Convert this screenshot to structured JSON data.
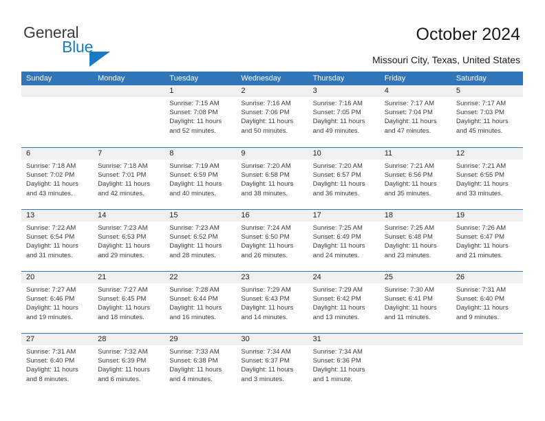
{
  "logo": {
    "word_one": "General",
    "word_two": "Blue",
    "triangle_icon": "triangle-icon",
    "accent_color": "#1a7bc4"
  },
  "header": {
    "title": "October 2024",
    "subtitle": "Missouri City, Texas, United States"
  },
  "theme": {
    "header_blue": "#3075b8",
    "date_band_gray": "#f0f0f0",
    "text_color": "#3a3a3a"
  },
  "calendar": {
    "day_headers": [
      "Sunday",
      "Monday",
      "Tuesday",
      "Wednesday",
      "Thursday",
      "Friday",
      "Saturday"
    ],
    "weeks": [
      [
        {
          "day": "",
          "empty": true
        },
        {
          "day": "",
          "empty": true
        },
        {
          "day": "1",
          "sunrise": "Sunrise: 7:15 AM",
          "sunset": "Sunset: 7:08 PM",
          "daylight": "Daylight: 11 hours and 52 minutes."
        },
        {
          "day": "2",
          "sunrise": "Sunrise: 7:16 AM",
          "sunset": "Sunset: 7:06 PM",
          "daylight": "Daylight: 11 hours and 50 minutes."
        },
        {
          "day": "3",
          "sunrise": "Sunrise: 7:16 AM",
          "sunset": "Sunset: 7:05 PM",
          "daylight": "Daylight: 11 hours and 49 minutes."
        },
        {
          "day": "4",
          "sunrise": "Sunrise: 7:17 AM",
          "sunset": "Sunset: 7:04 PM",
          "daylight": "Daylight: 11 hours and 47 minutes."
        },
        {
          "day": "5",
          "sunrise": "Sunrise: 7:17 AM",
          "sunset": "Sunset: 7:03 PM",
          "daylight": "Daylight: 11 hours and 45 minutes."
        }
      ],
      [
        {
          "day": "6",
          "sunrise": "Sunrise: 7:18 AM",
          "sunset": "Sunset: 7:02 PM",
          "daylight": "Daylight: 11 hours and 43 minutes."
        },
        {
          "day": "7",
          "sunrise": "Sunrise: 7:18 AM",
          "sunset": "Sunset: 7:01 PM",
          "daylight": "Daylight: 11 hours and 42 minutes."
        },
        {
          "day": "8",
          "sunrise": "Sunrise: 7:19 AM",
          "sunset": "Sunset: 6:59 PM",
          "daylight": "Daylight: 11 hours and 40 minutes."
        },
        {
          "day": "9",
          "sunrise": "Sunrise: 7:20 AM",
          "sunset": "Sunset: 6:58 PM",
          "daylight": "Daylight: 11 hours and 38 minutes."
        },
        {
          "day": "10",
          "sunrise": "Sunrise: 7:20 AM",
          "sunset": "Sunset: 6:57 PM",
          "daylight": "Daylight: 11 hours and 36 minutes."
        },
        {
          "day": "11",
          "sunrise": "Sunrise: 7:21 AM",
          "sunset": "Sunset: 6:56 PM",
          "daylight": "Daylight: 11 hours and 35 minutes."
        },
        {
          "day": "12",
          "sunrise": "Sunrise: 7:21 AM",
          "sunset": "Sunset: 6:55 PM",
          "daylight": "Daylight: 11 hours and 33 minutes."
        }
      ],
      [
        {
          "day": "13",
          "sunrise": "Sunrise: 7:22 AM",
          "sunset": "Sunset: 6:54 PM",
          "daylight": "Daylight: 11 hours and 31 minutes."
        },
        {
          "day": "14",
          "sunrise": "Sunrise: 7:23 AM",
          "sunset": "Sunset: 6:53 PM",
          "daylight": "Daylight: 11 hours and 29 minutes."
        },
        {
          "day": "15",
          "sunrise": "Sunrise: 7:23 AM",
          "sunset": "Sunset: 6:52 PM",
          "daylight": "Daylight: 11 hours and 28 minutes."
        },
        {
          "day": "16",
          "sunrise": "Sunrise: 7:24 AM",
          "sunset": "Sunset: 6:50 PM",
          "daylight": "Daylight: 11 hours and 26 minutes."
        },
        {
          "day": "17",
          "sunrise": "Sunrise: 7:25 AM",
          "sunset": "Sunset: 6:49 PM",
          "daylight": "Daylight: 11 hours and 24 minutes."
        },
        {
          "day": "18",
          "sunrise": "Sunrise: 7:25 AM",
          "sunset": "Sunset: 6:48 PM",
          "daylight": "Daylight: 11 hours and 23 minutes."
        },
        {
          "day": "19",
          "sunrise": "Sunrise: 7:26 AM",
          "sunset": "Sunset: 6:47 PM",
          "daylight": "Daylight: 11 hours and 21 minutes."
        }
      ],
      [
        {
          "day": "20",
          "sunrise": "Sunrise: 7:27 AM",
          "sunset": "Sunset: 6:46 PM",
          "daylight": "Daylight: 11 hours and 19 minutes."
        },
        {
          "day": "21",
          "sunrise": "Sunrise: 7:27 AM",
          "sunset": "Sunset: 6:45 PM",
          "daylight": "Daylight: 11 hours and 18 minutes."
        },
        {
          "day": "22",
          "sunrise": "Sunrise: 7:28 AM",
          "sunset": "Sunset: 6:44 PM",
          "daylight": "Daylight: 11 hours and 16 minutes."
        },
        {
          "day": "23",
          "sunrise": "Sunrise: 7:29 AM",
          "sunset": "Sunset: 6:43 PM",
          "daylight": "Daylight: 11 hours and 14 minutes."
        },
        {
          "day": "24",
          "sunrise": "Sunrise: 7:29 AM",
          "sunset": "Sunset: 6:42 PM",
          "daylight": "Daylight: 11 hours and 13 minutes."
        },
        {
          "day": "25",
          "sunrise": "Sunrise: 7:30 AM",
          "sunset": "Sunset: 6:41 PM",
          "daylight": "Daylight: 11 hours and 11 minutes."
        },
        {
          "day": "26",
          "sunrise": "Sunrise: 7:31 AM",
          "sunset": "Sunset: 6:40 PM",
          "daylight": "Daylight: 11 hours and 9 minutes."
        }
      ],
      [
        {
          "day": "27",
          "sunrise": "Sunrise: 7:31 AM",
          "sunset": "Sunset: 6:40 PM",
          "daylight": "Daylight: 11 hours and 8 minutes."
        },
        {
          "day": "28",
          "sunrise": "Sunrise: 7:32 AM",
          "sunset": "Sunset: 6:39 PM",
          "daylight": "Daylight: 11 hours and 6 minutes."
        },
        {
          "day": "29",
          "sunrise": "Sunrise: 7:33 AM",
          "sunset": "Sunset: 6:38 PM",
          "daylight": "Daylight: 11 hours and 4 minutes."
        },
        {
          "day": "30",
          "sunrise": "Sunrise: 7:34 AM",
          "sunset": "Sunset: 6:37 PM",
          "daylight": "Daylight: 11 hours and 3 minutes."
        },
        {
          "day": "31",
          "sunrise": "Sunrise: 7:34 AM",
          "sunset": "Sunset: 6:36 PM",
          "daylight": "Daylight: 11 hours and 1 minute."
        },
        {
          "day": "",
          "empty": true
        },
        {
          "day": "",
          "empty": true
        }
      ]
    ]
  }
}
